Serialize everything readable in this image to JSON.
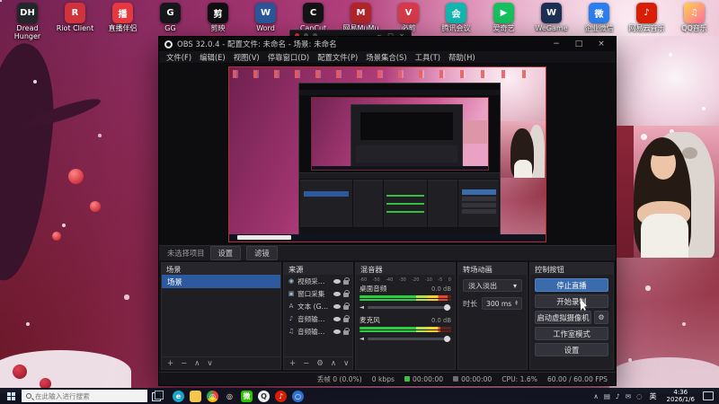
{
  "desktop": {
    "icons": [
      {
        "label": "Dread Hunger",
        "bg": "#23272b",
        "glyph": "DH"
      },
      {
        "label": "Riot Client",
        "bg": "#d0333c",
        "glyph": "R"
      },
      {
        "label": "直播伴侣",
        "bg": "#e6393f",
        "glyph": "播"
      },
      {
        "label": "GG",
        "bg": "#17181c",
        "glyph": "G"
      },
      {
        "label": "剪映",
        "bg": "#101013",
        "glyph": "剪"
      },
      {
        "label": "Word",
        "bg": "#2b579a",
        "glyph": "W"
      },
      {
        "label": "CapCut",
        "bg": "#141416",
        "glyph": "C"
      },
      {
        "label": "网易MuMu",
        "bg": "#b0252a",
        "glyph": "M"
      },
      {
        "label": "必剪",
        "bg": "#d63a4a",
        "glyph": "V"
      },
      {
        "label": "腾讯会议",
        "bg": "#12b7b0",
        "glyph": "会"
      },
      {
        "label": "爱奇艺",
        "bg": "#17c15f",
        "glyph": "▶"
      },
      {
        "label": "WeGame",
        "bg": "#1d2f55",
        "glyph": "W"
      },
      {
        "label": "企业微信",
        "bg": "#2d7ff0",
        "glyph": "微"
      },
      {
        "label": "网易云音乐",
        "bg": "#d81e06",
        "glyph": "♪"
      },
      {
        "label": "QQ音乐",
        "bg": "linear-gradient(135deg,#ffd24a,#ff6ea0)",
        "glyph": "♫"
      }
    ]
  },
  "obs": {
    "window_title": "OBS 32.0.4 - 配置文件: 未命名 - 场景: 未命名",
    "window_buttons": [
      "−",
      "□",
      "×"
    ],
    "menu": [
      "文件(F)",
      "编辑(E)",
      "视图(V)",
      "停靠窗口(D)",
      "配置文件(P)",
      "场景集合(S)",
      "工具(T)",
      "帮助(H)"
    ],
    "context": {
      "no_selection": "未选择项目",
      "buttons": [
        "设置",
        "滤镜"
      ]
    },
    "scenes": {
      "title": "场景",
      "items": [
        {
          "label": "场景",
          "cls": "selected"
        }
      ],
      "toolbar": [
        "+",
        "−",
        "∧",
        "∨"
      ]
    },
    "sources": {
      "title": "来源",
      "items": [
        {
          "glyph": "◉",
          "label": "视频采集设备"
        },
        {
          "glyph": "▣",
          "label": "窗口采集"
        },
        {
          "glyph": "A",
          "label": "文本 (GDI+)"
        },
        {
          "glyph": "♪",
          "label": "音频输出采集"
        },
        {
          "glyph": "♫",
          "label": "音频输入采集"
        }
      ],
      "toolbar": [
        "+",
        "−",
        "⚙",
        "∧",
        "∨"
      ]
    },
    "mixer": {
      "title": "混音器",
      "scale": [
        "-60",
        "-50",
        "-40",
        "-30",
        "-20",
        "-10",
        "-5",
        "0"
      ],
      "channels": [
        {
          "name": "桌面音频",
          "db": "0.0 dB",
          "fill": "96%"
        },
        {
          "name": "麦克风",
          "db": "0.0 dB",
          "fill": "88%"
        }
      ]
    },
    "transitions": {
      "title": "转场动画",
      "selected": "淡入淡出",
      "arrow": "▾",
      "duration_label": "时长",
      "duration": "300 ms"
    },
    "controls": {
      "title": "控制按钮",
      "buttons": [
        {
          "label": "停止直播",
          "cls": "accent"
        },
        {
          "label": "开始录制"
        },
        {
          "label": "启动虚拟摄像机",
          "gear": true
        },
        {
          "label": "工作室模式"
        },
        {
          "label": "设置"
        }
      ]
    },
    "status": {
      "dropped": "丢帧 0 (0.0%)",
      "bitrate": "0 kbps",
      "stream_time": "00:00:00",
      "rec_time": "00:00:00",
      "cpu": "CPU: 1.6%",
      "fps": "60.00 / 60.00 FPS"
    }
  },
  "taskbar": {
    "search_placeholder": "在此输入进行搜索",
    "apps": [
      {
        "name": "edge",
        "bg": "#1ca5c9",
        "glyph": "e",
        "cls": "round"
      },
      {
        "name": "file-explorer",
        "bg": "#f6c64a",
        "glyph": ""
      },
      {
        "name": "chrome",
        "bg": "conic-gradient(#ea4335 0 120deg,#fbbc05 120deg 240deg,#34a853 240deg 360deg)",
        "glyph": "◎",
        "cls": "round"
      },
      {
        "name": "obs",
        "bg": "#15151a",
        "glyph": "◎",
        "cls": "round"
      },
      {
        "name": "wechat",
        "bg": "#2dc100",
        "glyph": "微"
      },
      {
        "name": "qq",
        "bg": "#f0f0f0",
        "glyph": "Q",
        "fg": "#333",
        "cls": "round"
      },
      {
        "name": "netease-music",
        "bg": "#d81e06",
        "glyph": "♪",
        "cls": "round"
      },
      {
        "name": "browser",
        "bg": "#2f6fce",
        "glyph": "○",
        "cls": "round"
      }
    ],
    "tray_icons": [
      "∧",
      "▤",
      "♪",
      "✉",
      "◌"
    ],
    "tray": {
      "lang": "英",
      "time": "4:36",
      "date": "2026/1/6"
    }
  }
}
